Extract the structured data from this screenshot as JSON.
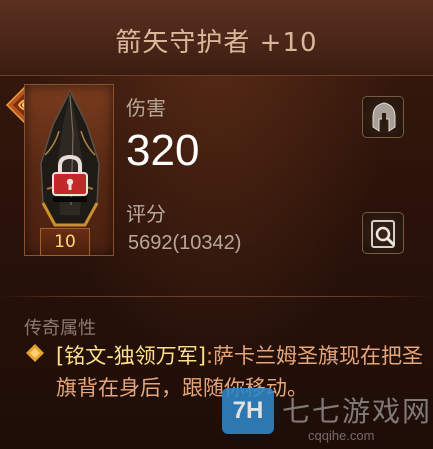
{
  "item": {
    "name": "箭矢守护者 +10",
    "level": "10"
  },
  "stats": {
    "damage_label": "伤害",
    "damage_value": "320",
    "score_label": "评分",
    "score_value": "5692(10342)"
  },
  "legendary": {
    "section_title": "传奇属性",
    "name": "[铭文-独领万军]",
    "separator": ":",
    "description": "萨卡兰姆圣旗现在把圣旗背在身后，跟随你移动。"
  },
  "watermark": {
    "logo_text": "7H",
    "name": "七七游戏网",
    "url": "cqqihe.com"
  },
  "icons": {
    "rune_badge": "rune-badge-icon",
    "item": "helmet-item-icon",
    "lock": "lock-icon",
    "class": "spartan-helmet-icon",
    "inspect": "magnify-icon",
    "legend_bullet": "diamond-bullet-icon"
  },
  "colors": {
    "title": "#d8b79a",
    "level": "#ffd97a",
    "legend_name": "#ffe08a",
    "legend_body": "#e6a57a",
    "damage_value": "#ffffff"
  }
}
